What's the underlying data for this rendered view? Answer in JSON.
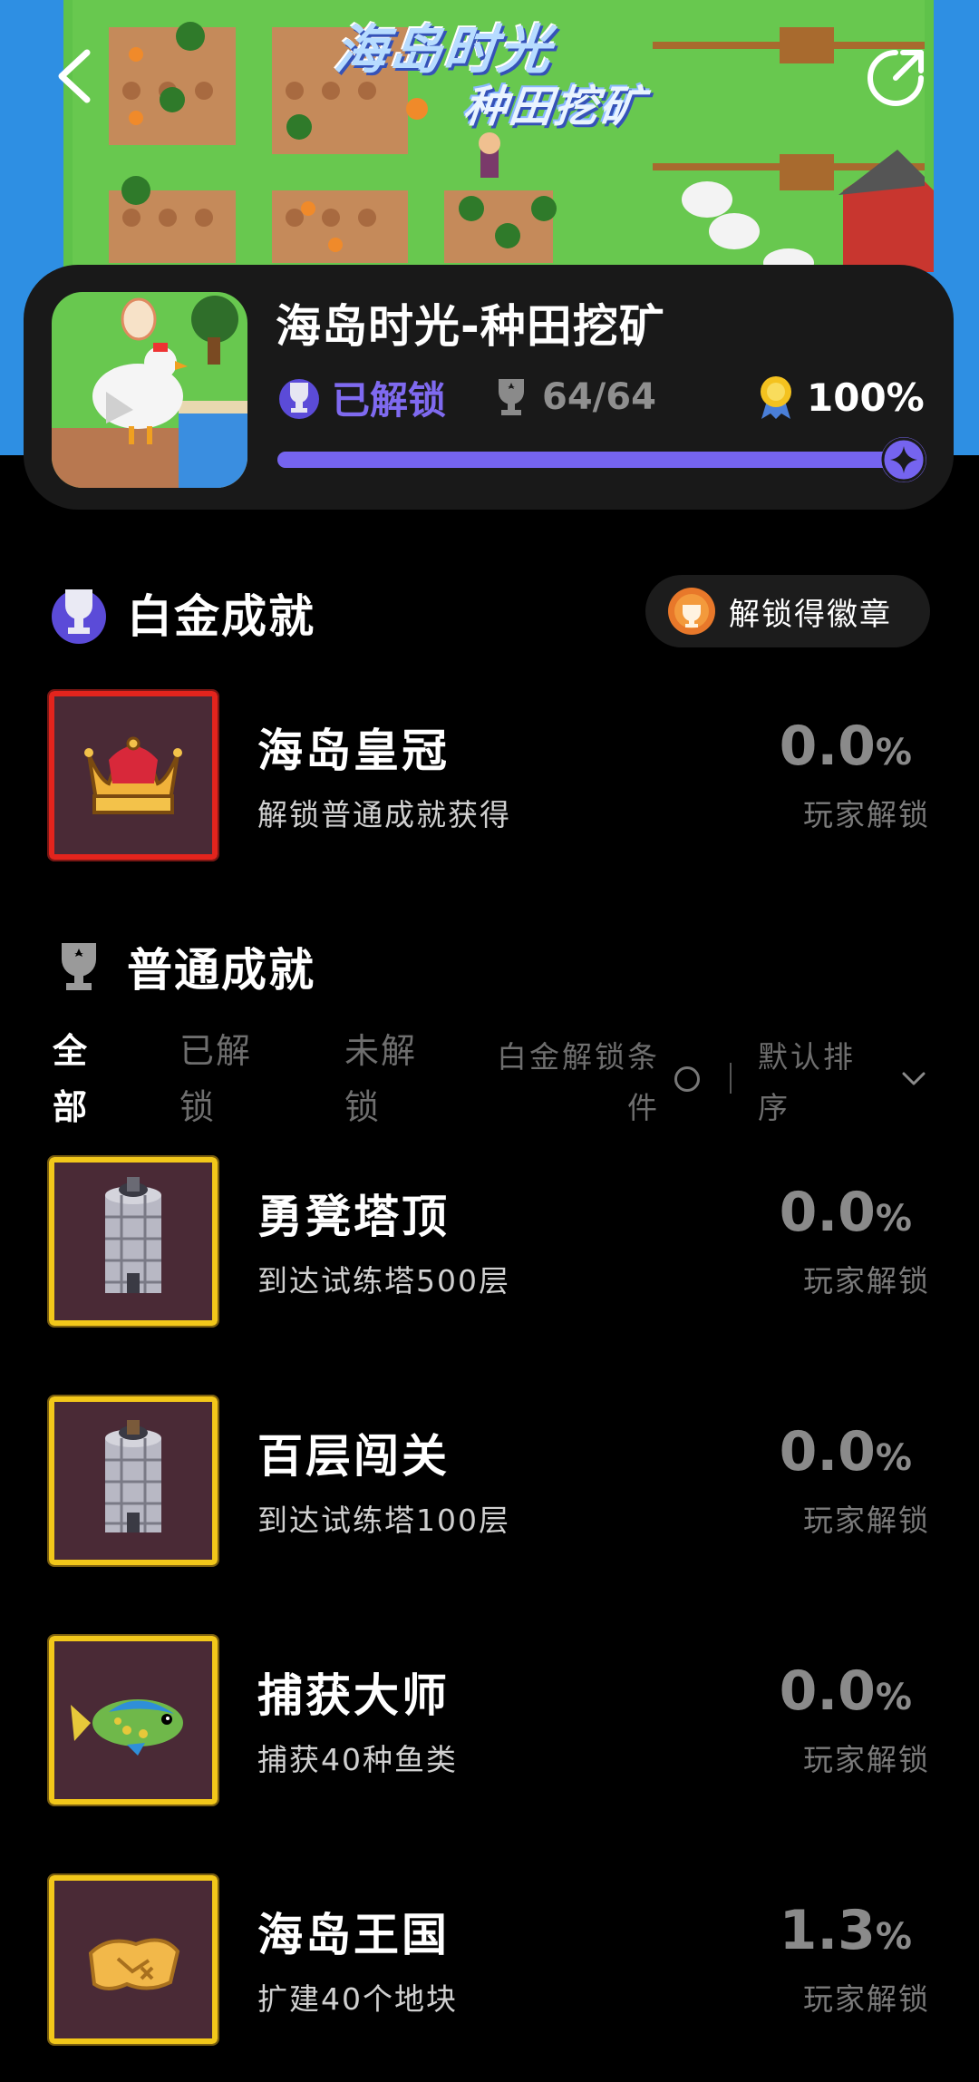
{
  "banner": {
    "title": "海岛时光",
    "subtitle": "种田挖矿"
  },
  "header": {
    "back_icon": "chevron-left-icon",
    "share_icon": "share-icon"
  },
  "game": {
    "title": "海岛时光-种田挖矿",
    "status": "已解锁",
    "count": "64/64",
    "percent": "100%",
    "progress": 1.0,
    "accent": "#7564ef"
  },
  "platinum": {
    "section_title": "白金成就",
    "badge_button": "解锁得徽章",
    "items": [
      {
        "name": "海岛皇冠",
        "desc": "解锁普通成就获得",
        "pct": "0.0",
        "unit": "%",
        "players": "玩家解锁"
      }
    ]
  },
  "normal": {
    "section_title": "普通成就",
    "filters": {
      "all": "全部",
      "unlocked": "已解锁",
      "locked": "未解锁",
      "platinum_condition": "白金解锁条件",
      "sort": "默认排序"
    },
    "items": [
      {
        "name": "勇凳塔顶",
        "desc": "到达试练塔500层",
        "pct": "0.0",
        "unit": "%",
        "players": "玩家解锁"
      },
      {
        "name": "百层闯关",
        "desc": "到达试练塔100层",
        "pct": "0.0",
        "unit": "%",
        "players": "玩家解锁"
      },
      {
        "name": "捕获大师",
        "desc": "捕获40种鱼类",
        "pct": "0.0",
        "unit": "%",
        "players": "玩家解锁"
      },
      {
        "name": "海岛王国",
        "desc": "扩建40个地块",
        "pct": "1.3",
        "unit": "%",
        "players": "玩家解锁"
      }
    ]
  }
}
